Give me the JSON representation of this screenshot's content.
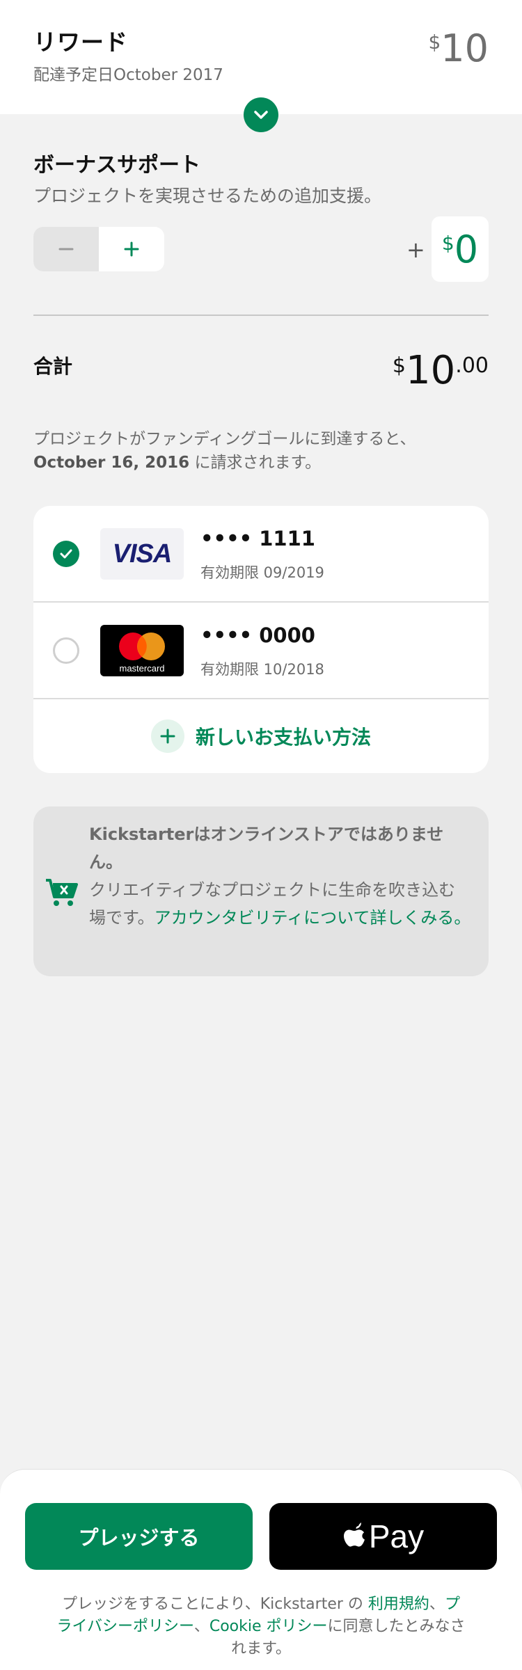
{
  "reward": {
    "title": "リワード",
    "delivery": "配達予定日October 2017",
    "currency": "$",
    "amount": "10"
  },
  "bonus": {
    "title": "ボーナスサポート",
    "description": "プロジェクトを実現させるための追加支援。",
    "stepper_minus": "−",
    "stepper_plus": "+",
    "plus_sign": "+",
    "currency": "$",
    "amount": "0"
  },
  "total": {
    "label": "合計",
    "currency": "$",
    "amount": "10",
    "cents": ".00"
  },
  "charge_note": {
    "prefix": "プロジェクトがファンディングゴールに到達すると、",
    "date": "October 16, 2016",
    "suffix": " に請求されます。"
  },
  "payment": {
    "cards": [
      {
        "brand": "VISA",
        "number": "•••• 1111",
        "expiry": "有効期限 09/2019",
        "selected": true
      },
      {
        "brand": "mastercard",
        "number": "•••• 0000",
        "expiry": "有効期限 10/2018",
        "selected": false
      }
    ],
    "new_method_label": "新しいお支払い方法"
  },
  "notice": {
    "strong": "Kickstarterはオンラインストアではありません。",
    "text": "クリエイティブなプロジェクトに生命を吹き込む場です。",
    "link": "アカウンタビリティについて詳しくみる。"
  },
  "footer": {
    "pledge_label": "プレッジする",
    "applepay_label": "Pay",
    "legal_prefix": "プレッジをすることにより、Kickstarter の ",
    "terms_link": "利用規約",
    "sep1": "、",
    "privacy_link": "プライバシーポリシー",
    "sep2": "、",
    "cookie_link": "Cookie ポリシー",
    "legal_suffix": "に同意したとみなされます。"
  },
  "colors": {
    "accent": "#028858",
    "background": "#f2f2f2"
  }
}
